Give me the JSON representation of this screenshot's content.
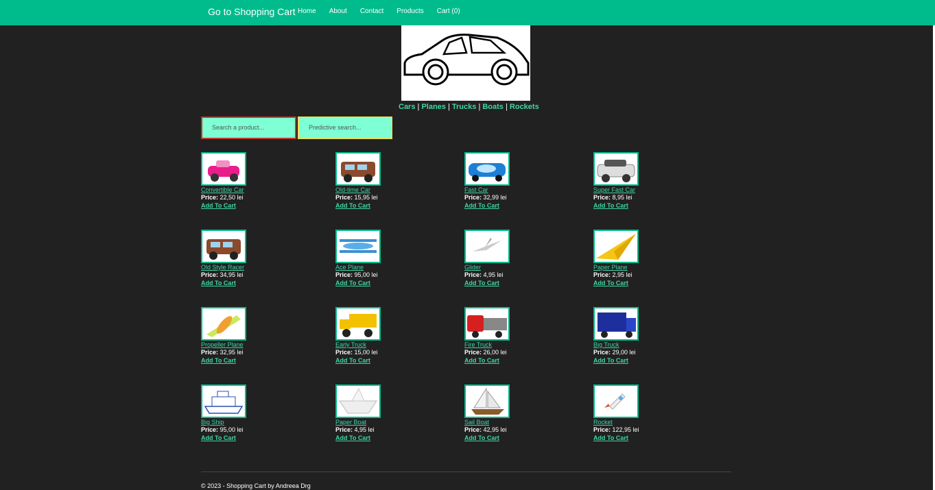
{
  "navbar": {
    "brand": "Go to Shopping Cart",
    "links": [
      "Home",
      "About",
      "Contact",
      "Products",
      "Cart (0)"
    ]
  },
  "categories": [
    "Cars",
    "Planes",
    "Trucks",
    "Boats",
    "Rockets"
  ],
  "search": {
    "product_placeholder": "Search a product...",
    "predictive_placeholder": "Predictive search..."
  },
  "products": [
    {
      "name": "Convertible Car",
      "price": "22,50 lei",
      "icon": "pink-convertible-car"
    },
    {
      "name": "Old-time Car",
      "price": "15,95 lei",
      "icon": "tow-truck-character"
    },
    {
      "name": "Fast Car",
      "price": "32,99 lei",
      "icon": "blue-race-car"
    },
    {
      "name": "Super Fast Car",
      "price": "8,95 lei",
      "icon": "white-suv"
    },
    {
      "name": "Old Style Racer",
      "price": "34,95 lei",
      "icon": "tow-truck-character"
    },
    {
      "name": "Ace Plane",
      "price": "95,00 lei",
      "icon": "biplane"
    },
    {
      "name": "Glider",
      "price": "4,95 lei",
      "icon": "glider"
    },
    {
      "name": "Paper Plane",
      "price": "2,95 lei",
      "icon": "paper-plane"
    },
    {
      "name": "Propeller Plane",
      "price": "32,95 lei",
      "icon": "propeller-plane"
    },
    {
      "name": "Early Truck",
      "price": "15,00 lei",
      "icon": "dump-truck"
    },
    {
      "name": "Fire Truck",
      "price": "26,00 lei",
      "icon": "red-truck"
    },
    {
      "name": "Big Truck",
      "price": "29,00 lei",
      "icon": "blue-truck"
    },
    {
      "name": "Big Ship",
      "price": "95,00 lei",
      "icon": "ship-sketch"
    },
    {
      "name": "Paper Boat",
      "price": "4,95 lei",
      "icon": "paper-boat"
    },
    {
      "name": "Sail Boat",
      "price": "42,95 lei",
      "icon": "sail-boat"
    },
    {
      "name": "Rocket",
      "price": "122,95 lei",
      "icon": "rocket"
    }
  ],
  "labels": {
    "price": "Price:",
    "add_to_cart": "Add To Cart"
  },
  "footer": "© 2023 - Shopping Cart by Andreea Drg",
  "colors": {
    "accent": "#00bc8c",
    "background": "#212121",
    "search_bg": "#7fffd4"
  }
}
